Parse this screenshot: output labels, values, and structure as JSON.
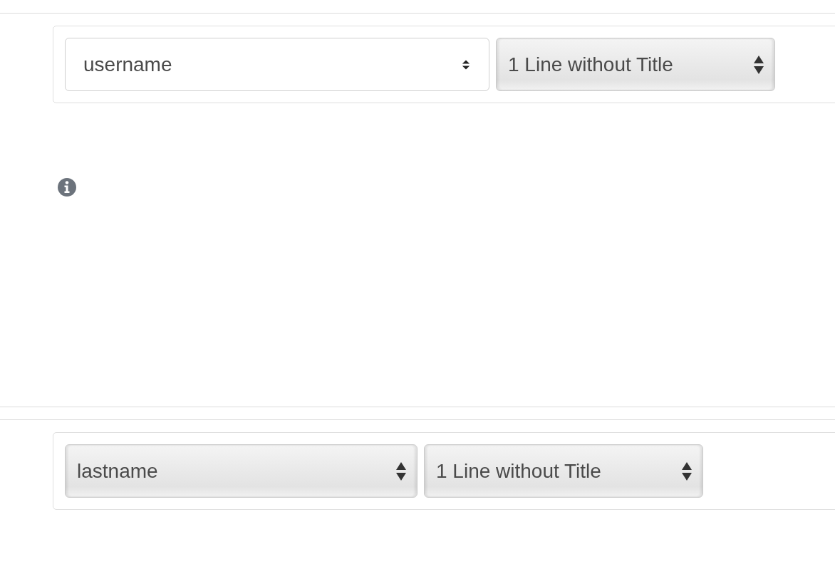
{
  "sections": [
    {
      "selects": [
        {
          "kind": "plain",
          "value": "username"
        },
        {
          "kind": "native",
          "value": "1 Line without Title"
        }
      ]
    },
    {
      "selects": [
        {
          "kind": "native",
          "value": "lastname"
        },
        {
          "kind": "native",
          "value": "1 Line without Title"
        }
      ]
    }
  ]
}
